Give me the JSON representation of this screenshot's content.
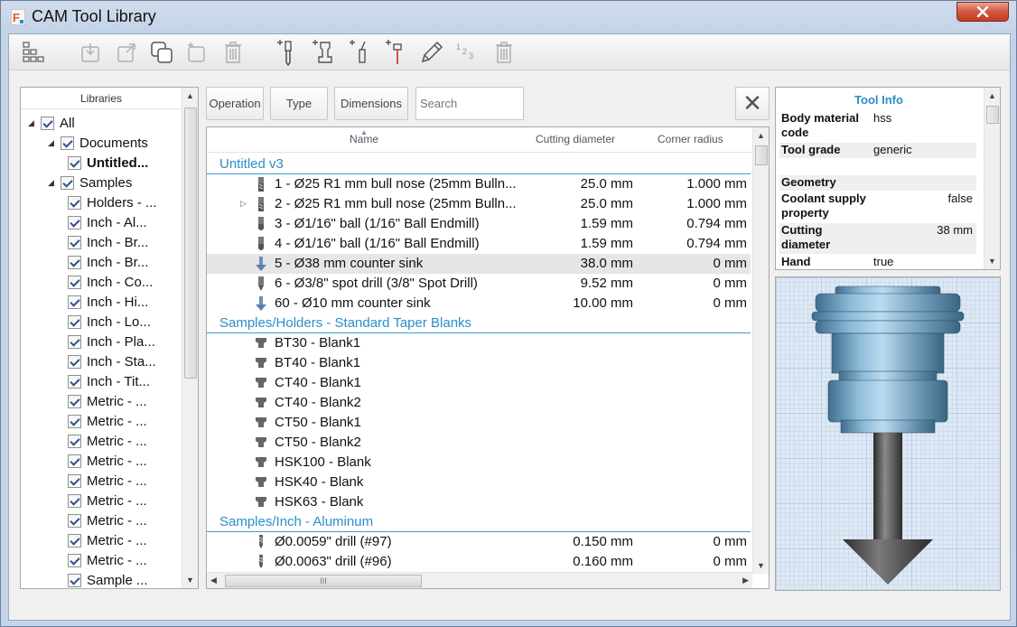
{
  "window": {
    "title": "CAM Tool Library"
  },
  "toolbar": {
    "buttons": [
      {
        "icon": "library-grid-icon"
      },
      {
        "icon": "import-icon"
      },
      {
        "icon": "export-icon"
      },
      {
        "icon": "duplicate-icon"
      },
      {
        "icon": "new-library-icon"
      },
      {
        "icon": "delete-library-icon"
      },
      {
        "icon": "new-tool-icon"
      },
      {
        "icon": "new-holder-icon"
      },
      {
        "icon": "new-tool-alt-icon"
      },
      {
        "icon": "new-probe-icon"
      },
      {
        "icon": "edit-pencil-icon"
      },
      {
        "icon": "renumber-icon"
      },
      {
        "icon": "delete-tool-icon"
      }
    ]
  },
  "libraries": {
    "header": "Libraries",
    "tree": [
      {
        "label": "All",
        "level": 0,
        "expanded": true,
        "checked": true
      },
      {
        "label": "Documents",
        "level": 1,
        "expanded": true,
        "checked": true
      },
      {
        "label": "Untitled...",
        "level": 2,
        "checked": true,
        "bold": true
      },
      {
        "label": "Samples",
        "level": 1,
        "expanded": true,
        "checked": true
      },
      {
        "label": "Holders - ...",
        "level": 2,
        "checked": true
      },
      {
        "label": "Inch - Al...",
        "level": 2,
        "checked": true
      },
      {
        "label": "Inch - Br...",
        "level": 2,
        "checked": true
      },
      {
        "label": "Inch - Br...",
        "level": 2,
        "checked": true
      },
      {
        "label": "Inch - Co...",
        "level": 2,
        "checked": true
      },
      {
        "label": "Inch - Hi...",
        "level": 2,
        "checked": true
      },
      {
        "label": "Inch - Lo...",
        "level": 2,
        "checked": true
      },
      {
        "label": "Inch - Pla...",
        "level": 2,
        "checked": true
      },
      {
        "label": "Inch - Sta...",
        "level": 2,
        "checked": true
      },
      {
        "label": "Inch - Tit...",
        "level": 2,
        "checked": true
      },
      {
        "label": "Metric - ...",
        "level": 2,
        "checked": true
      },
      {
        "label": "Metric - ...",
        "level": 2,
        "checked": true
      },
      {
        "label": "Metric - ...",
        "level": 2,
        "checked": true
      },
      {
        "label": "Metric - ...",
        "level": 2,
        "checked": true
      },
      {
        "label": "Metric - ...",
        "level": 2,
        "checked": true
      },
      {
        "label": "Metric - ...",
        "level": 2,
        "checked": true
      },
      {
        "label": "Metric - ...",
        "level": 2,
        "checked": true
      },
      {
        "label": "Metric - ...",
        "level": 2,
        "checked": true
      },
      {
        "label": "Metric - ...",
        "level": 2,
        "checked": true
      },
      {
        "label": "Sample ...",
        "level": 2,
        "checked": true
      }
    ]
  },
  "filters": {
    "operation": "Operation",
    "type": "Type",
    "dimensions": "Dimensions",
    "search_placeholder": "Search",
    "clear": "✕"
  },
  "columns": {
    "name": "Name",
    "diameter": "Cutting diameter",
    "radius": "Corner radius"
  },
  "groups": [
    {
      "title": "Untitled v3",
      "rows": [
        {
          "name": "1 - Ø25 R1 mm bull nose (25mm Bulln...",
          "dia": "25.0 mm",
          "rad": "1.000 mm",
          "icon": "bullnose-icon"
        },
        {
          "name": "2 - Ø25 R1 mm bull nose (25mm Bulln...",
          "dia": "25.0 mm",
          "rad": "1.000 mm",
          "icon": "bullnose-icon",
          "expander": true
        },
        {
          "name": "3 - Ø1/16\" ball (1/16\" Ball Endmill)",
          "dia": "1.59 mm",
          "rad": "0.794 mm",
          "icon": "ball-endmill-icon"
        },
        {
          "name": "4 - Ø1/16\" ball (1/16\" Ball Endmill)",
          "dia": "1.59 mm",
          "rad": "0.794 mm",
          "icon": "ball-endmill-icon"
        },
        {
          "name": "5 - Ø38 mm counter sink",
          "dia": "38.0 mm",
          "rad": "0 mm",
          "icon": "countersink-icon",
          "selected": true
        },
        {
          "name": "6 - Ø3/8\" spot drill (3/8\" Spot Drill)",
          "dia": "9.52 mm",
          "rad": "0 mm",
          "icon": "spot-drill-icon"
        },
        {
          "name": "60 - Ø10 mm counter sink",
          "dia": "10.00 mm",
          "rad": "0 mm",
          "icon": "countersink-icon"
        }
      ]
    },
    {
      "title": "Samples/Holders - Standard Taper Blanks",
      "rows": [
        {
          "name": "BT30 - Blank1",
          "dia": "",
          "rad": "",
          "icon": "holder-icon"
        },
        {
          "name": "BT40 - Blank1",
          "dia": "",
          "rad": "",
          "icon": "holder-icon"
        },
        {
          "name": "CT40 - Blank1",
          "dia": "",
          "rad": "",
          "icon": "holder-icon"
        },
        {
          "name": "CT40 - Blank2",
          "dia": "",
          "rad": "",
          "icon": "holder-icon"
        },
        {
          "name": "CT50 - Blank1",
          "dia": "",
          "rad": "",
          "icon": "holder-icon"
        },
        {
          "name": "CT50 - Blank2",
          "dia": "",
          "rad": "",
          "icon": "holder-icon"
        },
        {
          "name": "HSK100 - Blank",
          "dia": "",
          "rad": "",
          "icon": "holder-icon"
        },
        {
          "name": "HSK40 - Blank",
          "dia": "",
          "rad": "",
          "icon": "holder-icon"
        },
        {
          "name": "HSK63 - Blank",
          "dia": "",
          "rad": "",
          "icon": "holder-icon"
        }
      ]
    },
    {
      "title": "Samples/Inch - Aluminum",
      "rows": [
        {
          "name": "Ø0.0059\" drill (#97)",
          "dia": "0.150 mm",
          "rad": "0 mm",
          "icon": "drill-icon"
        },
        {
          "name": "Ø0.0063\" drill (#96)",
          "dia": "0.160 mm",
          "rad": "0 mm",
          "icon": "drill-icon"
        }
      ]
    }
  ],
  "tool_info": {
    "title": "Tool Info",
    "rows": [
      {
        "key": "Body material code",
        "value": "hss",
        "align": "left",
        "lines": 2
      },
      {
        "key": "Tool grade",
        "value": "generic",
        "align": "left",
        "lines": 1
      },
      {
        "key": "",
        "value": "",
        "align": "left",
        "lines": 1,
        "blank": true
      },
      {
        "key": "Geometry",
        "value": "",
        "align": "left",
        "lines": 1,
        "section": true
      },
      {
        "key": "Coolant supply property",
        "value": "false",
        "align": "right",
        "lines": 2
      },
      {
        "key": "Cutting diameter",
        "value": "38 mm",
        "align": "right",
        "lines": 2
      },
      {
        "key": "Hand",
        "value": "true",
        "align": "left",
        "lines": 1
      }
    ]
  },
  "colors": {
    "accent": "#2a8fc9",
    "selection": "#e6e6e6",
    "preview_grid": "#b6cde4"
  }
}
